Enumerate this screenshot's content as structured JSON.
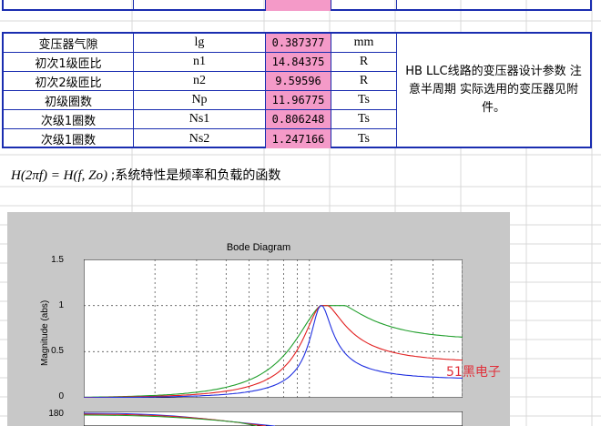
{
  "params_table": {
    "rows": [
      {
        "name": "变压器气隙",
        "symbol": "lg",
        "value": "0.387377",
        "unit": "mm"
      },
      {
        "name": "初次1级匝比",
        "symbol": "n1",
        "value": "14.84375",
        "unit": "R"
      },
      {
        "name": "初次2级匝比",
        "symbol": "n2",
        "value": "9.59596",
        "unit": "R"
      },
      {
        "name": "初级圈数",
        "symbol": "Np",
        "value": "11.96775",
        "unit": "Ts"
      },
      {
        "name": "次级1圈数",
        "symbol": "Ns1",
        "value": "0.806248",
        "unit": "Ts"
      },
      {
        "name": "次级1圈数",
        "symbol": "Ns2",
        "value": "1.247166",
        "unit": "Ts"
      }
    ],
    "note": "HB LLC线路的变压器设计参数 注意半周期 实际选用的变压器见附件。"
  },
  "formula": {
    "expr": "H(2πf) = H(f, Zo)",
    "text": ";系统特性是频率和负载的函数"
  },
  "figure": {
    "title": "Bode Diagram",
    "ylabel": "Magnitude (abs)",
    "yticks": [
      "1.5",
      "1",
      "0.5",
      "0"
    ],
    "phase_tick": "180",
    "watermark": "51黑电子"
  },
  "chart_data": {
    "type": "line",
    "title": "Bode Diagram",
    "xlabel": "",
    "ylabel": "Magnitude (abs)",
    "ylim": [
      0,
      1.5
    ],
    "xscale": "log",
    "grid": true,
    "series": [
      {
        "color": "#1f9e2a",
        "x": [
          0.1,
          0.3,
          0.5,
          0.7,
          0.85,
          1.0,
          1.2,
          1.6,
          2.5,
          4.0
        ],
        "values": [
          0.0,
          0.03,
          0.15,
          0.45,
          0.8,
          1.0,
          0.75,
          0.4,
          0.18,
          0.08
        ]
      },
      {
        "color": "#e22020",
        "x": [
          0.1,
          0.3,
          0.5,
          0.7,
          0.85,
          1.0,
          1.2,
          1.6,
          2.5,
          4.0
        ],
        "values": [
          0.0,
          0.02,
          0.08,
          0.25,
          0.6,
          1.0,
          0.62,
          0.28,
          0.12,
          0.05
        ]
      },
      {
        "color": "#2030e0",
        "x": [
          0.1,
          0.3,
          0.5,
          0.7,
          0.85,
          1.0,
          1.2,
          1.6,
          2.5,
          4.0
        ],
        "values": [
          0.0,
          0.01,
          0.04,
          0.12,
          0.35,
          1.0,
          0.4,
          0.14,
          0.05,
          0.02
        ]
      }
    ]
  }
}
